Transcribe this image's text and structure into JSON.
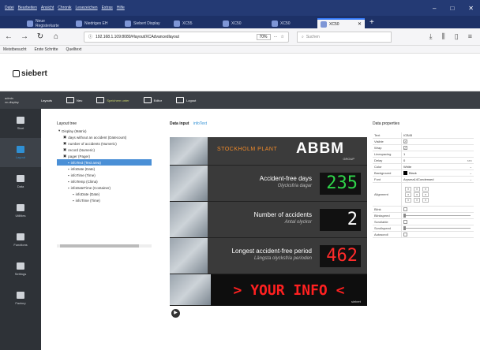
{
  "menu": [
    "Datei",
    "Bearbeiten",
    "Ansicht",
    "Chronik",
    "Lesezeichen",
    "Extras",
    "Hilfe"
  ],
  "window_controls": [
    "–",
    "□",
    "✕"
  ],
  "tabs": [
    {
      "label": "Neue Registerkarte",
      "active": false
    },
    {
      "label": "Niedriges EH",
      "active": false
    },
    {
      "label": "Siebert Display",
      "active": false
    },
    {
      "label": "XC55",
      "active": false
    },
    {
      "label": "XC50",
      "active": false
    },
    {
      "label": "XC50",
      "active": false
    },
    {
      "label": "XC50",
      "active": true
    }
  ],
  "nav": {
    "url": "192.168.1.109:8080/#layout/XCAdvancedlayout",
    "zoom": "70%",
    "search_placeholder": "Suchen"
  },
  "bookmarks": [
    "Meistbesucht",
    "Erste Schritte",
    "Quelltext"
  ],
  "brand": "siebert",
  "toolbar": {
    "admin": "admin\nxc-display",
    "items": [
      "Layouts",
      "Neu",
      "Speichern unter",
      "Editor",
      "Logout"
    ]
  },
  "sidebar": [
    "Start",
    "Layout",
    "Data",
    "Utilities",
    "Functions",
    "Settings",
    "Factory"
  ],
  "layout_tree": {
    "title": "Layout tree",
    "rows": [
      {
        "label": "Display (Matrix)",
        "indent": 0,
        "selected": false
      },
      {
        "label": "days without an accident (Datecount)",
        "indent": 1,
        "selected": false
      },
      {
        "label": "number of accidents (Numeric)",
        "indent": 1,
        "selected": false
      },
      {
        "label": "record (Numeric)",
        "indent": 1,
        "selected": false
      },
      {
        "label": "pager (Pager)",
        "indent": 1,
        "selected": false
      },
      {
        "label": "infoText (Text area)",
        "indent": 2,
        "selected": true
      },
      {
        "label": "infoDate (Date)",
        "indent": 2,
        "selected": false
      },
      {
        "label": "infoTime (Time)",
        "indent": 2,
        "selected": false
      },
      {
        "label": "infoTemp (Clima)",
        "indent": 2,
        "selected": false
      },
      {
        "label": "infoDateTime (Container)",
        "indent": 2,
        "selected": false
      },
      {
        "label": "infoDate (Date)",
        "indent": 3,
        "selected": false
      },
      {
        "label": "infoTime (Time)",
        "indent": 3,
        "selected": false
      }
    ]
  },
  "data_input": {
    "title": "Data input",
    "link": "infoText"
  },
  "display": {
    "header": "STOCKHOLM PLANT",
    "brand": "ABBM",
    "brand_sub": "GROUP",
    "rows": [
      {
        "label": "Accident-free days",
        "sub": "Olycksfria dagar",
        "value": "235",
        "color": "#2fd34a"
      },
      {
        "label": "Number of accidents",
        "sub": "Antal olyckor",
        "value": "2",
        "color": "#ffffff"
      },
      {
        "label": "Longest accident-free period",
        "sub": "Längsta olycksfria perioden",
        "value": "462",
        "color": "#ff2b2b"
      }
    ],
    "ticker": "> YOUR INFO <",
    "footer_logo": "siebert"
  },
  "properties": {
    "title": "Data properties",
    "rows": [
      {
        "k": "Text",
        "v": "ICB45"
      },
      {
        "k": "Visible",
        "check": true
      },
      {
        "k": "Wrap",
        "check": true
      },
      {
        "k": "Linespacing",
        "v": "1"
      },
      {
        "k": "Delay",
        "v": "0",
        "unit": "sec"
      },
      {
        "k": "Color",
        "v": "White"
      },
      {
        "k": "Background",
        "v": "Black",
        "swatch": true
      },
      {
        "k": "Font",
        "v": "Arysma14Condensed"
      },
      {
        "k": "Alignment",
        "align": true
      },
      {
        "k": "Blink",
        "check": false
      },
      {
        "k": "Blinkspeed",
        "slider": true
      },
      {
        "k": "Scrollable",
        "check": false
      },
      {
        "k": "Scrollspeed",
        "slider": true
      },
      {
        "k": "Autoscroll",
        "check": false
      }
    ]
  }
}
